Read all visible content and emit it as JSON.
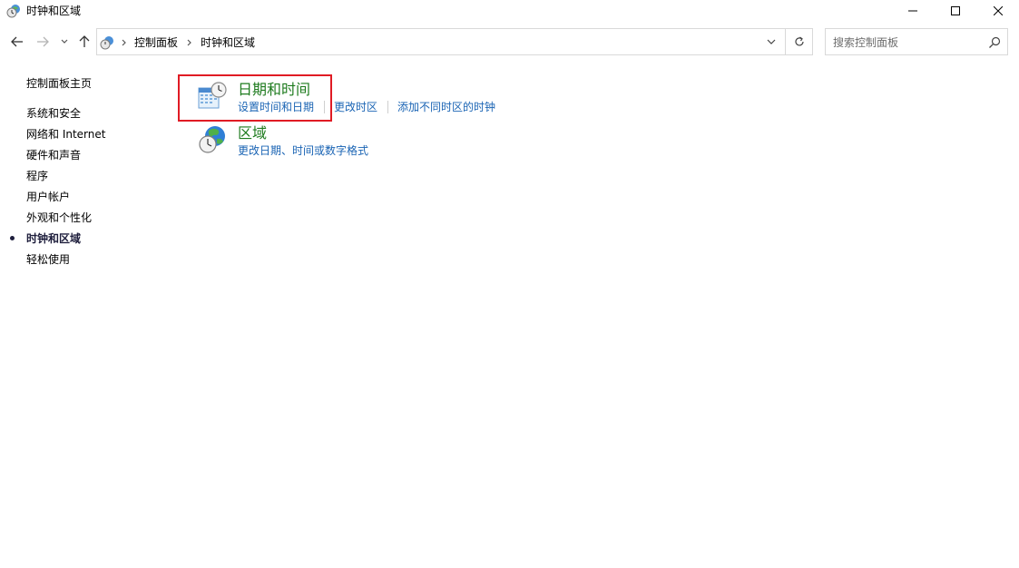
{
  "window": {
    "title": "时钟和区域",
    "icon": "clock-globe-icon"
  },
  "nav": {
    "breadcrumb": [
      "控制面板",
      "时钟和区域"
    ]
  },
  "search": {
    "placeholder": "搜索控制面板"
  },
  "sidebar": {
    "items": [
      {
        "label": "控制面板主页",
        "active": false
      },
      {
        "label": "系统和安全",
        "active": false
      },
      {
        "label": "网络和 Internet",
        "active": false
      },
      {
        "label": "硬件和声音",
        "active": false
      },
      {
        "label": "程序",
        "active": false
      },
      {
        "label": "用户帐户",
        "active": false
      },
      {
        "label": "外观和个性化",
        "active": false
      },
      {
        "label": "时钟和区域",
        "active": true
      },
      {
        "label": "轻松使用",
        "active": false
      }
    ]
  },
  "categories": [
    {
      "title": "日期和时间",
      "icon": "calendar-clock-icon",
      "links": [
        "设置时间和日期",
        "更改时区",
        "添加不同时区的时钟"
      ]
    },
    {
      "title": "区域",
      "icon": "globe-clock-icon",
      "links": [
        "更改日期、时间或数字格式"
      ]
    }
  ],
  "colors": {
    "category_title": "#1e7b1e",
    "link": "#1a64b4",
    "highlight": "#e01b24"
  }
}
